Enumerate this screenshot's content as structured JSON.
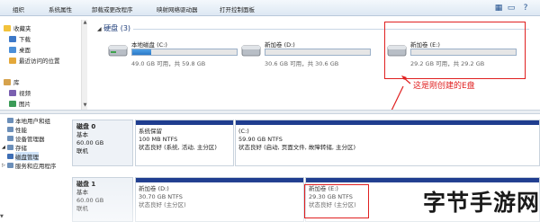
{
  "toolbar": {
    "items": [
      "组织",
      "系统属性",
      "卸载或更改程序",
      "映射网络驱动器",
      "打开控制面板"
    ],
    "view_icon": "view-icon",
    "preview_icon": "preview-pane-icon",
    "help_icon": "help-icon"
  },
  "nav": {
    "favorites_label": "收藏夹",
    "items": [
      "下载",
      "桌面",
      "最近访问的位置"
    ],
    "library_label": "库",
    "library_items": [
      "视频",
      "图片"
    ]
  },
  "drives": {
    "group_header": "硬盘 (3)",
    "list": [
      {
        "name": "本地磁盘 (C:)",
        "free_text": "49.0 GB 可用，共 59.8 GB",
        "used_fraction": 0.18
      },
      {
        "name": "新加卷 (D:)",
        "free_text": "30.6 GB 可用，共 30.6 GB",
        "used_fraction": 0.0
      },
      {
        "name": "新加卷 (E:)",
        "free_text": "29.2 GB 可用，共 29.2 GB",
        "used_fraction": 0.0
      }
    ]
  },
  "annotation": "这是刚创建的E盘",
  "tree": {
    "items": [
      "本地用户和组",
      "性能",
      "设备管理器",
      "存储",
      "磁盘管理",
      "服务和应用程序"
    ]
  },
  "disks": [
    {
      "name": "磁盘 0",
      "type": "基本",
      "size": "60.00 GB",
      "status": "联机",
      "partitions": [
        {
          "title": "系统保留",
          "line1": "100 MB NTFS",
          "line2": "状态良好 (系统, 活动, 主分区)"
        },
        {
          "title": "(C:)",
          "line1": "59.90 GB NTFS",
          "line2": "状态良好 (启动, 页面文件, 故障转储, 主分区)"
        }
      ]
    },
    {
      "name": "磁盘 1",
      "type": "基本",
      "size": "60.00 GB",
      "status": "联机",
      "partitions": [
        {
          "title": "新加卷 (D:)",
          "line1": "30.70 GB NTFS",
          "line2": "状态良好 (主分区)"
        },
        {
          "title": "新加卷 (E:)",
          "line1": "29.30 GB NTFS",
          "line2": "状态良好 (主分区)"
        }
      ]
    }
  ],
  "watermark": "字节手游网",
  "colors": {
    "accent_red": "#e02020",
    "partition_header": "#1f3d8f",
    "bar_fill": "#2a78c8"
  }
}
